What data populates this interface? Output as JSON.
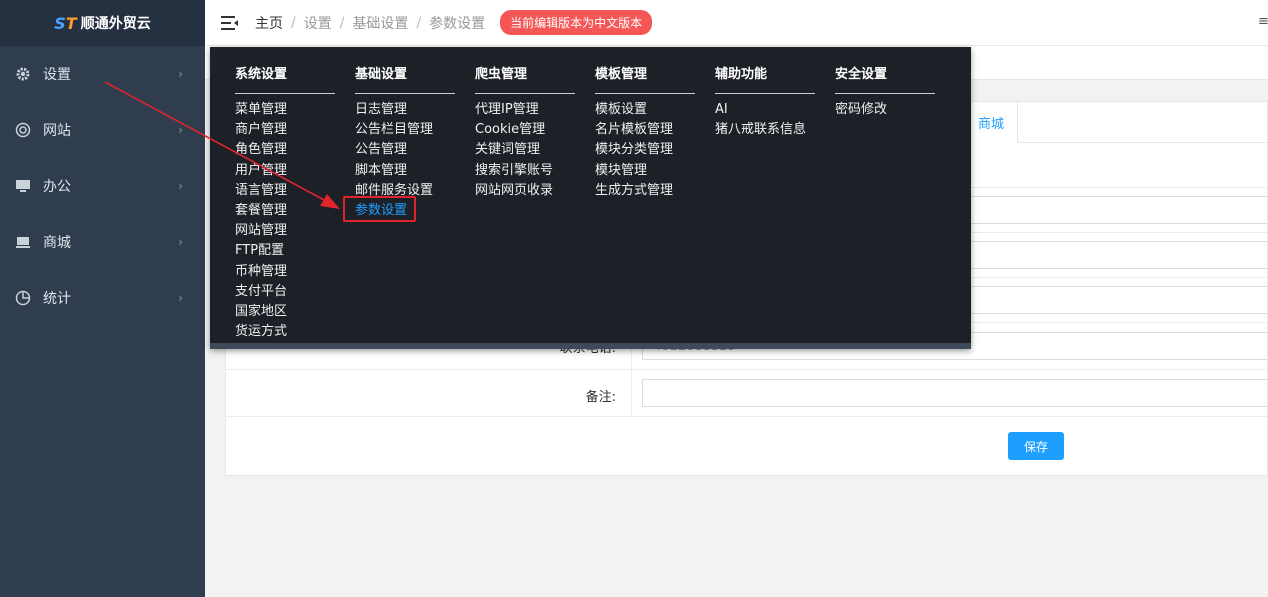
{
  "app": {
    "logo_mark": "ST",
    "logo_text": "顺通外贸云"
  },
  "sidebar": {
    "items": [
      {
        "label": "设置",
        "icon": "gear-icon"
      },
      {
        "label": "网站",
        "icon": "globe-icon"
      },
      {
        "label": "办公",
        "icon": "monitor-icon"
      },
      {
        "label": "商城",
        "icon": "store-icon"
      },
      {
        "label": "统计",
        "icon": "pie-chart-icon"
      }
    ]
  },
  "header": {
    "breadcrumb": [
      "主页",
      "设置",
      "基础设置",
      "参数设置"
    ],
    "badge": "当前编辑版本为中文版本",
    "right_glyph": "≡"
  },
  "tabs": {
    "mall": "商城"
  },
  "form": {
    "phone_label": "联系电话:",
    "phone_value": "4012888329",
    "remark_label": "备注:",
    "remark_value": "",
    "save": "保存"
  },
  "mega_menu": {
    "columns": [
      {
        "title": "系统设置",
        "items": [
          "菜单管理",
          "商户管理",
          "角色管理",
          "用户管理",
          "语言管理",
          "套餐管理",
          "网站管理",
          "FTP配置",
          "币种管理",
          "支付平台",
          "国家地区",
          "货运方式"
        ]
      },
      {
        "title": "基础设置",
        "items": [
          "日志管理",
          "公告栏目管理",
          "公告管理",
          "脚本管理",
          "邮件服务设置",
          "参数设置"
        ]
      },
      {
        "title": "爬虫管理",
        "items": [
          "代理IP管理",
          "Cookie管理",
          "关键词管理",
          "搜索引擎账号",
          "网站网页收录"
        ]
      },
      {
        "title": "模板管理",
        "items": [
          "模板设置",
          "名片模板管理",
          "模块分类管理",
          "模块管理",
          "生成方式管理"
        ]
      },
      {
        "title": "辅助功能",
        "items": [
          "AI",
          "猪八戒联系信息"
        ]
      },
      {
        "title": "安全设置",
        "items": [
          "密码修改"
        ]
      }
    ],
    "active_item": "参数设置"
  },
  "colors": {
    "sidebar_bg": "#2f3d4f",
    "menu_bg": "#1d2127",
    "accent": "#1e9fff",
    "badge": "#f55656",
    "annotation": "#e0242c"
  }
}
